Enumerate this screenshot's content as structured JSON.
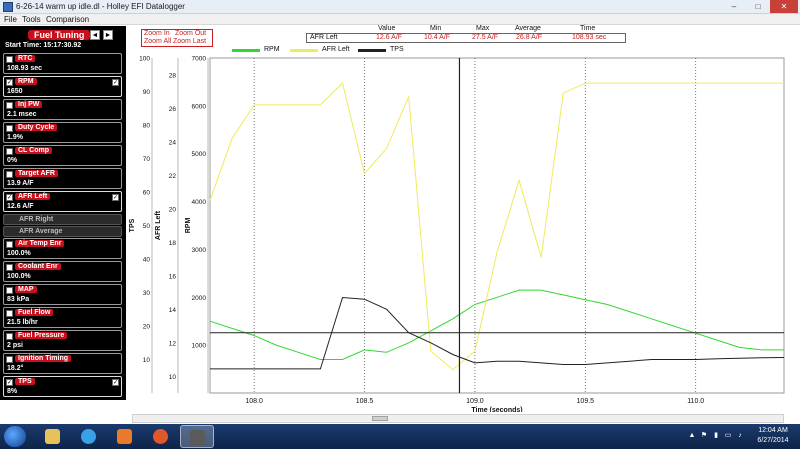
{
  "window": {
    "title": "6-26-14 warm up idle.dl - Holley EFI Datalogger",
    "minimize": "–",
    "maximize": "□",
    "close": "✕"
  },
  "menu": [
    "File",
    "Tools",
    "Comparison"
  ],
  "panel": {
    "title": "Fuel Tuning",
    "prev": "◄",
    "next": "►",
    "start_time": "Start Time: 15:17:30.92",
    "channels": [
      {
        "name": "RTC",
        "value": "108.93 sec",
        "checked": false
      },
      {
        "name": "RPM",
        "value": "1650",
        "checked": true
      },
      {
        "name": "Inj PW",
        "value": "2.1 msec",
        "checked": false
      },
      {
        "name": "Duty Cycle",
        "value": "1.9%",
        "checked": false
      },
      {
        "name": "CL Comp",
        "value": "0%",
        "checked": false
      },
      {
        "name": "Target AFR",
        "value": "13.9 A/F",
        "checked": false
      },
      {
        "name": "AFR Left",
        "value": "12.6 A/F",
        "checked": true
      },
      {
        "name": "AFR Right",
        "value": "",
        "checked": false
      },
      {
        "name": "AFR Average",
        "value": "",
        "checked": false
      },
      {
        "name": "Air Temp Enr",
        "value": "100.0%",
        "checked": false
      },
      {
        "name": "Coolant Enr",
        "value": "100.0%",
        "checked": false
      },
      {
        "name": "MAP",
        "value": "83 kPa",
        "checked": false
      },
      {
        "name": "Fuel Flow",
        "value": "21.5 lb/hr",
        "checked": false
      },
      {
        "name": "Fuel Pressure",
        "value": "2 psi",
        "checked": false
      },
      {
        "name": "Ignition Timing",
        "value": "18.2°",
        "checked": false
      },
      {
        "name": "TPS",
        "value": "8%",
        "checked": true
      }
    ]
  },
  "zoom": {
    "in": "Zoom In",
    "out": "Zoom Out",
    "all": "Zoom All",
    "last": "Zoom Last"
  },
  "stats": {
    "headers": [
      "Value",
      "Min",
      "Max",
      "Average",
      "Time"
    ],
    "channel": "AFR Left",
    "values": [
      "12.6 A/F",
      "10.4 A/F",
      "27.5 A/F",
      "26.8 A/F",
      "108.93 sec"
    ]
  },
  "legend": [
    {
      "name": "RPM",
      "color": "#33d633"
    },
    {
      "name": "AFR Left",
      "color": "#f0ea5c"
    },
    {
      "name": "TPS",
      "color": "#222222"
    }
  ],
  "chart_data": {
    "type": "line",
    "x": [
      107.8,
      107.9,
      108.0,
      108.1,
      108.2,
      108.3,
      108.4,
      108.5,
      108.6,
      108.7,
      108.8,
      108.9,
      109.0,
      109.1,
      109.2,
      109.3,
      109.4,
      109.5,
      109.6,
      109.7,
      109.8,
      109.9,
      110.0,
      110.1,
      110.2,
      110.3,
      110.4
    ],
    "xlabel": "Time (seconds)",
    "xlim": [
      107.8,
      110.4
    ],
    "xticks": [
      108.0,
      108.5,
      109.0,
      109.5,
      110.0
    ],
    "series": [
      {
        "name": "RPM",
        "axis": "RPM",
        "values": [
          1500,
          1350,
          1200,
          1000,
          850,
          700,
          700,
          900,
          850,
          1050,
          1300,
          1550,
          1850,
          2000,
          2150,
          2150,
          2050,
          1950,
          1850,
          1700,
          1550,
          1400,
          1250,
          1100,
          950,
          900,
          900
        ]
      },
      {
        "name": "AFR Left",
        "axis": "AFR Left",
        "values": [
          20.5,
          24.2,
          26.2,
          26.2,
          26.2,
          26.2,
          27.5,
          22.1,
          23.6,
          26.7,
          11.5,
          10.4,
          11.5,
          17.4,
          21.7,
          17.1,
          26.9,
          27.5,
          27.5,
          27.5,
          27.5,
          27.5,
          27.5,
          27.5,
          27.5,
          27.5,
          27.5
        ]
      },
      {
        "name": "TPS",
        "axis": "TPS",
        "values": [
          7.2,
          7.2,
          7.2,
          7.2,
          7.2,
          7.2,
          28.5,
          28.0,
          25.0,
          18.0,
          15.0,
          11.5,
          9.0,
          9.5,
          9.5,
          9.0,
          8.5,
          8.5,
          9.0,
          9.5,
          10.0,
          10.0,
          10.0,
          10.2,
          10.4,
          10.5,
          10.6
        ]
      }
    ],
    "axes": [
      {
        "label": "TPS",
        "min": 0,
        "max": 100,
        "ticks": [
          10,
          20,
          30,
          40,
          50,
          60,
          70,
          80,
          90,
          100
        ]
      },
      {
        "label": "AFR Left",
        "min": 9,
        "max": 29,
        "ticks": [
          10,
          12,
          14,
          16,
          18,
          20,
          22,
          24,
          26,
          28
        ]
      },
      {
        "label": "RPM",
        "min": 0,
        "max": 7000,
        "ticks": [
          1000,
          2000,
          3000,
          4000,
          5000,
          6000,
          7000
        ]
      }
    ],
    "cursor_x": 108.93,
    "reference_afr": 12.6,
    "grid": true
  },
  "taskbar": {
    "apps": [
      "windows-explorer",
      "internet-explorer",
      "media-player",
      "firefox",
      "holley-datalogger"
    ],
    "time": "12:04 AM",
    "date": "6/27/2014"
  }
}
